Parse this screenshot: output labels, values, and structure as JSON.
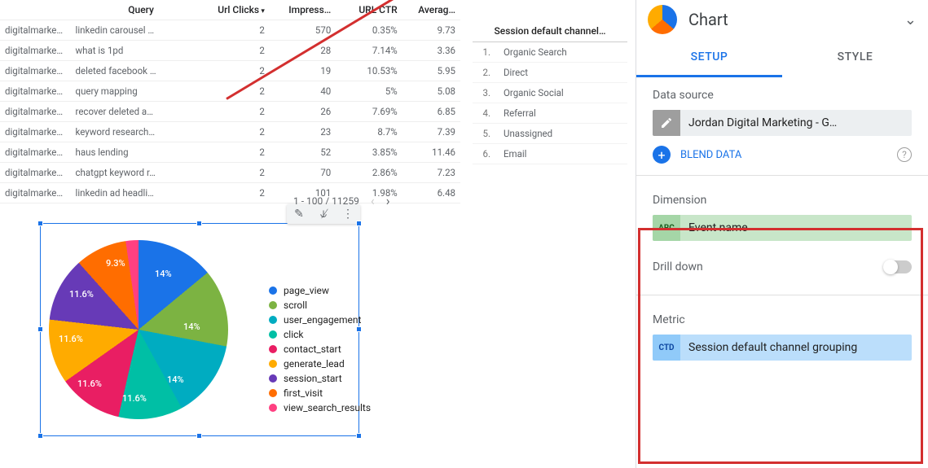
{
  "table1": {
    "headers": [
      "",
      "Query",
      "Url Clicks",
      "Impress…",
      "URL CTR",
      "Averag…"
    ],
    "rows": [
      [
        "digitalmarketing…",
        "linkedin carousel …",
        "2",
        "570",
        "0.35%",
        "9.73"
      ],
      [
        "digitalmarketing…",
        "what is 1pd",
        "2",
        "28",
        "7.14%",
        "3.36"
      ],
      [
        "digitalmarketing…",
        "deleted facebook …",
        "2",
        "19",
        "10.53%",
        "5.95"
      ],
      [
        "digitalmarketing…",
        "query mapping",
        "2",
        "40",
        "5%",
        "5.08"
      ],
      [
        "digitalmarketing…",
        "recover deleted a…",
        "2",
        "26",
        "7.69%",
        "6.85"
      ],
      [
        "digitalmarketing…",
        "keyword research…",
        "2",
        "23",
        "8.7%",
        "7.39"
      ],
      [
        "digitalmarketing…",
        "haus lending",
        "2",
        "52",
        "3.85%",
        "11.46"
      ],
      [
        "digitalmarketing…",
        "chatgpt keyword r…",
        "2",
        "70",
        "2.86%",
        "7.23"
      ],
      [
        "digitalmarketing…",
        "linkedin ad headli…",
        "2",
        "101",
        "1.98%",
        "6.48"
      ]
    ],
    "pager": "1 - 100 / 11259"
  },
  "table2": {
    "header": "Session default channel…",
    "rows": [
      [
        "1.",
        "Organic Search"
      ],
      [
        "2.",
        "Direct"
      ],
      [
        "3.",
        "Organic Social"
      ],
      [
        "4.",
        "Referral"
      ],
      [
        "5.",
        "Unassigned"
      ],
      [
        "6.",
        "Email"
      ]
    ]
  },
  "chart_data": {
    "type": "pie",
    "title": "",
    "series": [
      {
        "name": "page_view",
        "value": 14,
        "color": "#1a73e8"
      },
      {
        "name": "scroll",
        "value": 14,
        "color": "#7cb342"
      },
      {
        "name": "user_engagement",
        "value": 14,
        "color": "#00acc1"
      },
      {
        "name": "click",
        "value": 11.6,
        "color": "#00bfa5"
      },
      {
        "name": "contact_start",
        "value": 11.6,
        "color": "#e91e63"
      },
      {
        "name": "generate_lead",
        "value": 11.6,
        "color": "#ffab00"
      },
      {
        "name": "session_start",
        "value": 11.6,
        "color": "#673ab7"
      },
      {
        "name": "first_visit",
        "value": 9.3,
        "color": "#ff6d00"
      },
      {
        "name": "view_search_results",
        "value": 2.3,
        "color": "#ff4081"
      }
    ],
    "slice_labels": [
      "14%",
      "14%",
      "14%",
      "11.6%",
      "11.6%",
      "11.6%",
      "11.6%",
      "9.3%"
    ]
  },
  "panel": {
    "chart_type": "Chart",
    "tabs": {
      "setup": "SETUP",
      "style": "STYLE"
    },
    "data_source_label": "Data source",
    "data_source": "Jordan Digital Marketing - G…",
    "blend": "BLEND DATA",
    "dimension_label": "Dimension",
    "dimension_badge": "ABC",
    "dimension": "Event name",
    "drill_label": "Drill down",
    "metric_label": "Metric",
    "metric_badge": "CTD",
    "metric": "Session default channel grouping"
  }
}
